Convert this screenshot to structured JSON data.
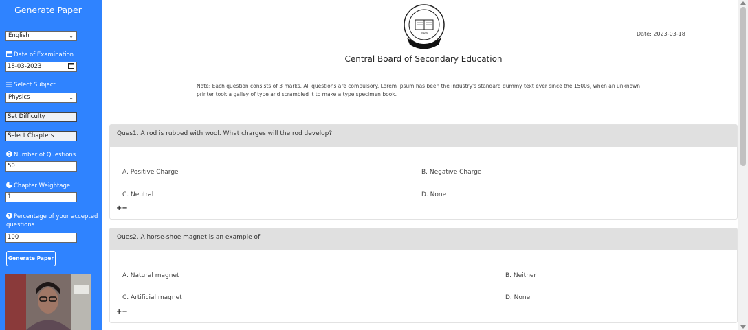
{
  "sidebar": {
    "title": "Generate Paper",
    "language": {
      "value": "English"
    },
    "date_exam": {
      "label": "Date of Examination",
      "value": "18-03-2023"
    },
    "subject": {
      "label": "Select Subject",
      "value": "Physics"
    },
    "difficulty_btn": "Set Difficulty",
    "chapters_btn": "Select Chapters",
    "num_questions": {
      "label": "Number of Questions",
      "value": "50"
    },
    "chapter_weightage": {
      "label": "Chapter Weightage",
      "value": "1"
    },
    "accepted_pct": {
      "label": "Percentage of your accepted questions",
      "value": "100"
    },
    "generate_btn": "Generate Paper"
  },
  "header": {
    "date": "Date: 2023-03-18",
    "board": "Central Board of Secondary Education",
    "logo_text": "INDIA",
    "note": "Note: Each question consists of 3 marks. All questions are compulsory. Lorem Ipsum has been the industry's standard dummy text ever since the 1500s, when an unknown printer took a galley of type and scrambled it to make a type specimen book."
  },
  "questions": [
    {
      "text": "Ques1. A rod is rubbed with wool. What charges will the rod develop?",
      "options": [
        "A. Positive Charge",
        "B. Negative Charge",
        "C. Neutral",
        "D. None"
      ],
      "controls": "+−"
    },
    {
      "text": "Ques2. A horse-shoe magnet is an example of",
      "options": [
        "A. Natural magnet",
        "B. Neither",
        "C. Artificial magnet",
        "D. None"
      ],
      "controls": "+−"
    }
  ],
  "colors": {
    "sidebar": "#2f83ff",
    "question_header": "#e0e0e0"
  }
}
